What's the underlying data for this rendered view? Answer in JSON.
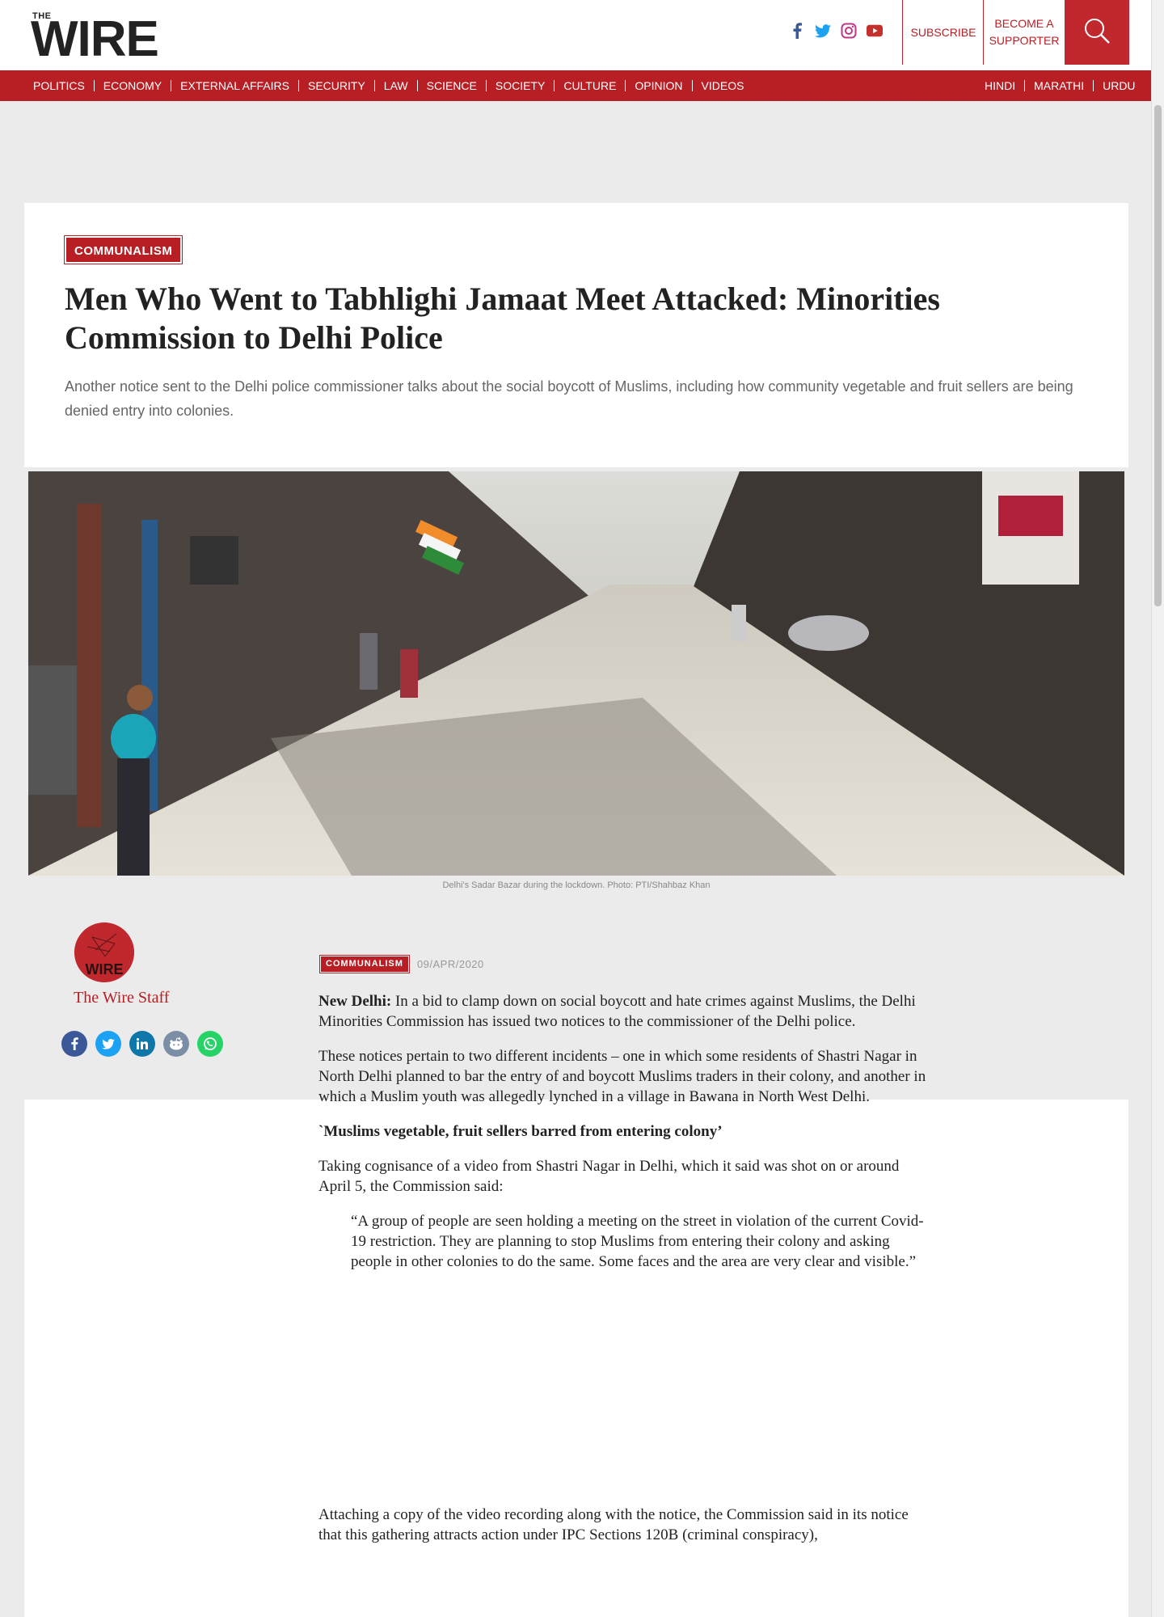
{
  "header": {
    "logo_the": "THE",
    "logo_wire": "WIRE",
    "subscribe": "SUBSCRIBE",
    "become_supporter_line1": "BECOME A",
    "become_supporter_line2": "SUPPORTER"
  },
  "nav": {
    "left": [
      "POLITICS",
      "ECONOMY",
      "EXTERNAL AFFAIRS",
      "SECURITY",
      "LAW",
      "SCIENCE",
      "SOCIETY",
      "CULTURE",
      "OPINION",
      "VIDEOS"
    ],
    "right": [
      "HINDI",
      "MARATHI",
      "URDU"
    ]
  },
  "colors": {
    "brand_red": "#b81f24"
  },
  "article": {
    "category": "COMMUNALISM",
    "title": "Men Who Went to Tabhlighi Jamaat Meet Attacked: Minorities Commission to Delhi Police",
    "standfirst": "Another notice sent to the Delhi police commissioner talks about the social boycott of Muslims, including how community vegetable and fruit sellers are being denied entry into colonies.",
    "caption": "Delhi's Sadar Bazar during the lockdown. Photo: PTI/Shahbaz Khan",
    "author": "The Wire Staff",
    "meta_category": "COMMUNALISM",
    "date": "09/APR/2020",
    "dateline": "New Delhi:",
    "p1": "In a bid to clamp down on social boycott and hate crimes against Muslims, the Delhi Minorities Commission has issued two notices to the commissioner of the Delhi police.",
    "p2": "These notices pertain to two different incidents – one in which some residents of Shastri Nagar in North Delhi planned to bar the entry of and boycott Muslims traders in their colony, and another in which a Muslim youth was allegedly lynched in a village in Bawana in North West Delhi.",
    "subheading": "`Muslims vegetable, fruit sellers barred from entering colony’",
    "p3": "Taking cognisance of a video from Shastri Nagar in Delhi, which it said was shot on or around April 5, the Commission said:",
    "quote": "“A group of people are seen holding a meeting on the street in violation of the current Covid-19 restriction. They are planning to stop Muslims from entering their colony and asking people in other colonies to do the same. Some faces and the area are very clear and visible.”",
    "p4": "Attaching a copy of the video recording along with the notice, the Commission said in its notice that this gathering attracts action under IPC Sections 120B (criminal conspiracy),"
  },
  "share_icons": [
    "facebook-icon",
    "twitter-icon",
    "linkedin-icon",
    "reddit-icon",
    "whatsapp-icon"
  ]
}
